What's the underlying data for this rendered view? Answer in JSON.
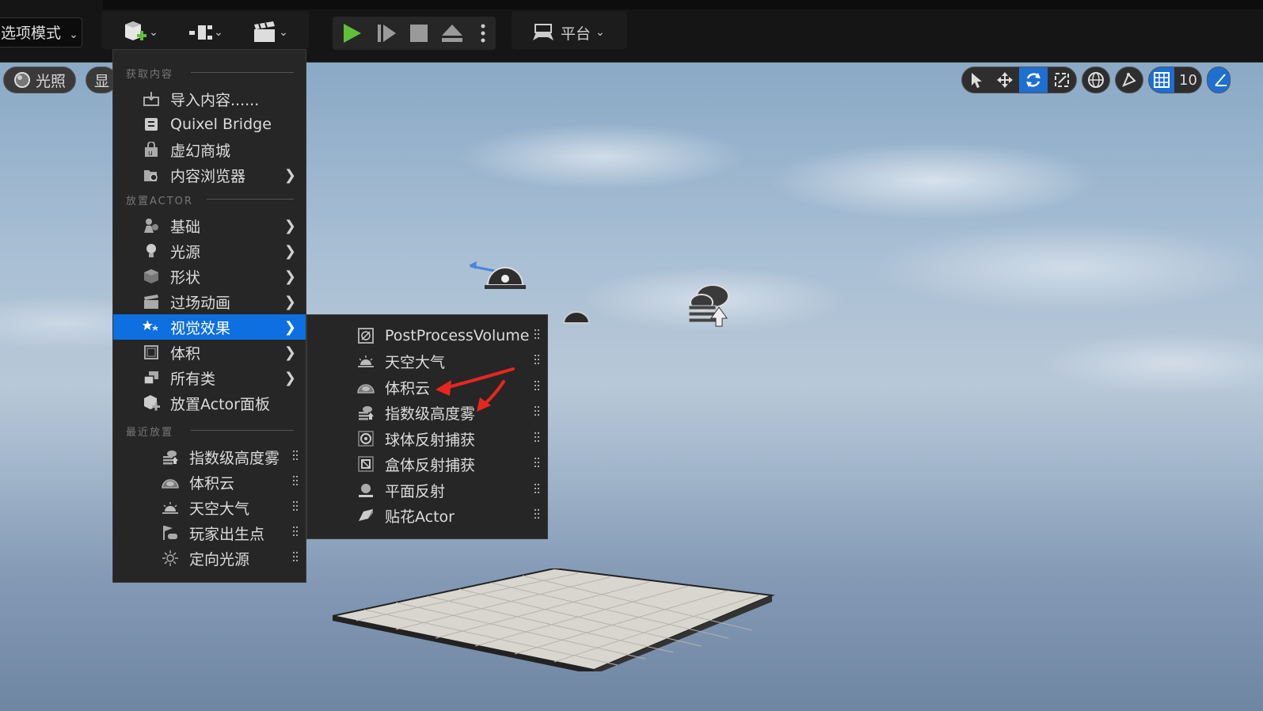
{
  "toolbar": {
    "mode_label": "选项模式",
    "platform_label": "平台"
  },
  "viewport": {
    "lighting_label": "光照",
    "show_label": "显",
    "grid_value": "10"
  },
  "main_menu": {
    "sections": [
      {
        "title": "获取内容",
        "items": [
          {
            "label": "导入内容......",
            "icon": "import-icon",
            "submenu": false
          },
          {
            "label": "Quixel Bridge",
            "icon": "bridge-icon",
            "submenu": false
          },
          {
            "label": "虚幻商城",
            "icon": "marketplace-icon",
            "submenu": false
          },
          {
            "label": "内容浏览器",
            "icon": "content-browser-icon",
            "submenu": true
          }
        ]
      },
      {
        "title": "放置ACTOR",
        "items": [
          {
            "label": "基础",
            "icon": "basic-icon",
            "submenu": true
          },
          {
            "label": "光源",
            "icon": "light-icon",
            "submenu": true
          },
          {
            "label": "形状",
            "icon": "shape-icon",
            "submenu": true
          },
          {
            "label": "过场动画",
            "icon": "cinematic-icon",
            "submenu": true
          },
          {
            "label": "视觉效果",
            "icon": "visual-effects-icon",
            "submenu": true,
            "highlighted": true
          },
          {
            "label": "体积",
            "icon": "volume-icon",
            "submenu": true
          },
          {
            "label": "所有类",
            "icon": "all-classes-icon",
            "submenu": true
          },
          {
            "label": "放置Actor面板",
            "icon": "place-actor-icon",
            "submenu": false
          }
        ]
      },
      {
        "title": "最近放置",
        "items": [
          {
            "label": "指数级高度雾",
            "icon": "height-fog-icon"
          },
          {
            "label": "体积云",
            "icon": "volumetric-cloud-icon"
          },
          {
            "label": "天空大气",
            "icon": "sky-atmosphere-icon"
          },
          {
            "label": "玩家出生点",
            "icon": "player-start-icon"
          },
          {
            "label": "定向光源",
            "icon": "directional-light-icon"
          }
        ]
      }
    ]
  },
  "sub_menu": {
    "items": [
      {
        "label": "PostProcessVolume",
        "icon": "post-process-icon"
      },
      {
        "label": "天空大气",
        "icon": "sky-atmosphere-icon"
      },
      {
        "label": "体积云",
        "icon": "volumetric-cloud-icon"
      },
      {
        "label": "指数级高度雾",
        "icon": "height-fog-icon"
      },
      {
        "label": "球体反射捕获",
        "icon": "sphere-reflection-icon"
      },
      {
        "label": "盒体反射捕获",
        "icon": "box-reflection-icon"
      },
      {
        "label": "平面反射",
        "icon": "planar-reflection-icon"
      },
      {
        "label": "贴花Actor",
        "icon": "decal-icon"
      }
    ]
  },
  "colors": {
    "highlight": "#0d6fe0",
    "play_green": "#5fbf3a",
    "annotation_red": "#e8261e"
  }
}
